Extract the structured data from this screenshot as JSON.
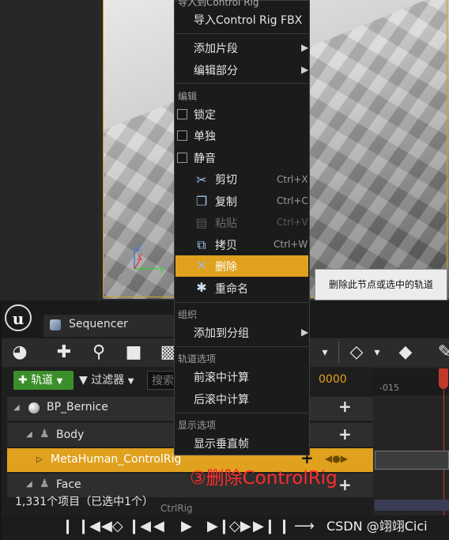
{
  "context_menu": {
    "top_cut_label": "导入到Control Rig",
    "import_fbx": "导入Control Rig FBX",
    "add_section": "添加片段",
    "edit_section": "编辑部分",
    "edit_header": "编辑",
    "lock": "锁定",
    "solo": "单独",
    "mute": "静音",
    "cut": "剪切",
    "cut_shortcut": "Ctrl+X",
    "copy": "复制",
    "copy_shortcut": "Ctrl+C",
    "paste": "粘贴",
    "paste_shortcut": "Ctrl+V",
    "duplicate": "拷贝",
    "duplicate_shortcut": "Ctrl+W",
    "delete": "删除",
    "rename": "重命名",
    "group_header": "组织",
    "add_to_group": "添加到分组",
    "track_options_header": "轨道选项",
    "pre_roll": "前滚中计算",
    "post_roll": "后滚中计算",
    "display_options_header": "显示选项",
    "show_vertical_frames": "显示垂直帧"
  },
  "tooltip": "删除此节点或选中的轨道",
  "viewport": {
    "help": "?"
  },
  "sequencer": {
    "logo": "u",
    "tab_title": "Sequencer",
    "track_button": "轨道",
    "filter_button": "过滤器",
    "search_placeholder": "搜索",
    "time_readout": "0000",
    "ruler_label": "-015",
    "rows": {
      "actor": "BP_Bernice",
      "body": "Body",
      "control_rig": "MetaHuman_ControlRig",
      "face": "Face"
    },
    "item_count": "1,331个项目（已选中1个）",
    "ghost_row": "CtrlRig"
  },
  "annotation": "③删除ControlRig",
  "watermark": "CSDN @翊翊Cici",
  "colors": {
    "highlight": "#e0a11f",
    "track_button": "#3b8f2a",
    "annotation": "#ff2d2d",
    "playhead": "#c0392b"
  }
}
